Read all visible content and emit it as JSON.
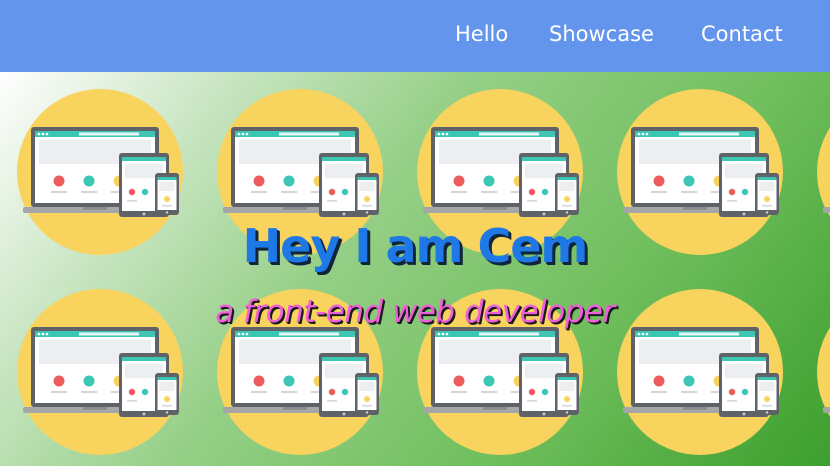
{
  "nav": {
    "items": [
      {
        "label": "Hello"
      },
      {
        "label": "Showcase"
      },
      {
        "label": "Contact"
      }
    ]
  },
  "hero": {
    "title": "Hey I am Cem",
    "subtitle": "a front-end web developer",
    "tile_icon": "responsive-devices-icon"
  },
  "colors": {
    "nav_bg": "#6495ed",
    "title": "#1e78e6",
    "subtitle": "#ee5fd8",
    "tile_circle": "#f8d35e"
  }
}
